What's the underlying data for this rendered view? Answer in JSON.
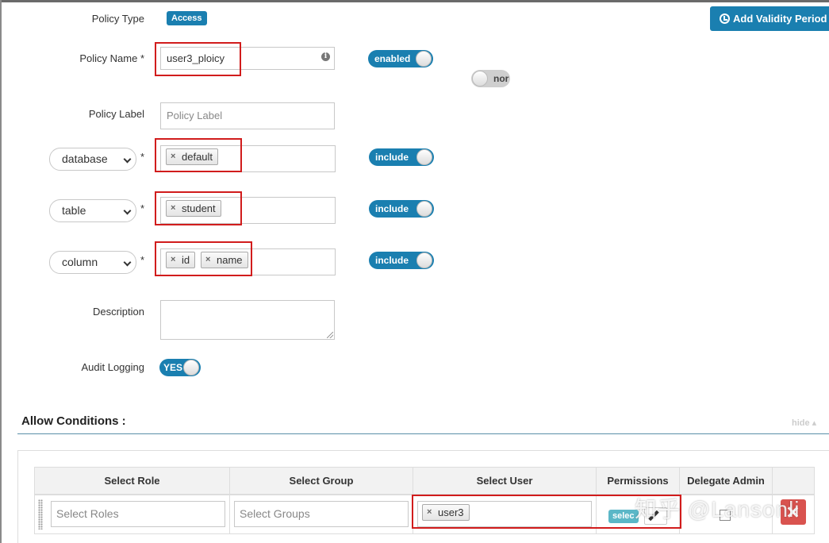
{
  "form": {
    "policy_type_label": "Policy Type",
    "policy_type_value": "Access",
    "add_validity_label": "Add Validity Period",
    "policy_name_label": "Policy Name *",
    "policy_name_value": "user3_ploicy",
    "enabled_toggle": "enabled",
    "override_toggle": "nor",
    "policy_label_label": "Policy Label",
    "policy_label_placeholder": "Policy Label",
    "resources": [
      {
        "type": "database",
        "tags": [
          "default"
        ],
        "mode": "include"
      },
      {
        "type": "table",
        "tags": [
          "student"
        ],
        "mode": "include"
      },
      {
        "type": "column",
        "tags": [
          "id",
          "name"
        ],
        "mode": "include"
      }
    ],
    "required_mark": "*",
    "description_label": "Description",
    "audit_logging_label": "Audit Logging",
    "audit_logging_value": "YES"
  },
  "allow": {
    "title": "Allow Conditions :",
    "hide_label": "hide",
    "columns": [
      "Select Role",
      "Select Group",
      "Select User",
      "Permissions",
      "Delegate Admin"
    ],
    "role_placeholder": "Select Roles",
    "group_placeholder": "Select Groups",
    "user_tags": [
      "user3"
    ],
    "permissions_badge": "selec"
  },
  "watermark": "知乎 @Lansonli",
  "colors": {
    "accent": "#1a7fb0",
    "highlight_box": "#d11c1c",
    "delete": "#d9534f"
  }
}
